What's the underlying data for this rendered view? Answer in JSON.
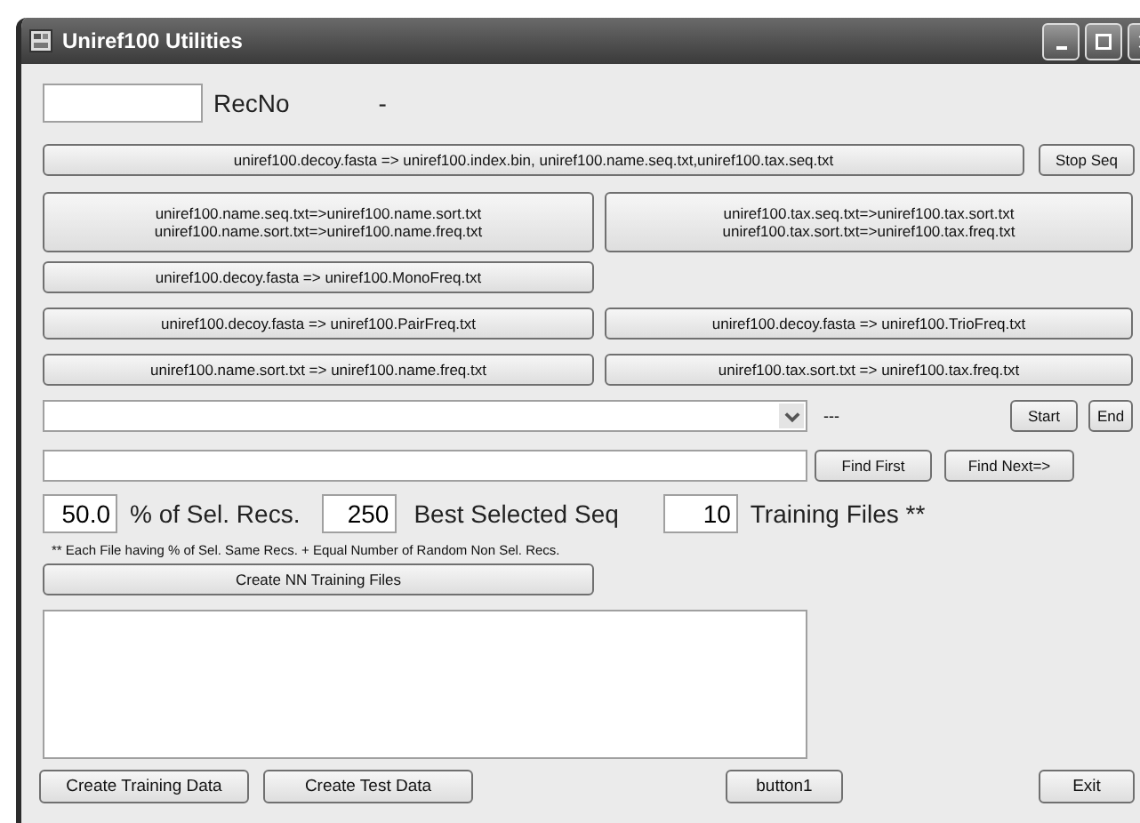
{
  "window": {
    "title": "Uniref100 Utilities"
  },
  "rec_no": {
    "label": "RecNo",
    "status": "-"
  },
  "main_action": {
    "label": "uniref100.decoy.fasta => uniref100.index.bin, uniref100.name.seq.txt,uniref100.tax.seq.txt"
  },
  "stop_button": "Stop Seq",
  "sort_buttons": [
    {
      "lines": [
        "uniref100.name.seq.txt=>uniref100.name.sort.txt",
        "uniref100.name.sort.txt=>uniref100.name.freq.txt"
      ]
    },
    {
      "lines": [
        "uniref100.tax.seq.txt=>uniref100.tax.sort.txt",
        "uniref100.tax.sort.txt=>uniref100.tax.freq.txt"
      ]
    }
  ],
  "mono_button": "uniref100.decoy.fasta => uniref100.MonoFreq.txt",
  "freq_buttons": [
    [
      "uniref100.decoy.fasta => uniref100.PairFreq.txt",
      "uniref100.decoy.fasta => uniref100.TrioFreq.txt"
    ],
    [
      "uniref100.name.sort.txt => uniref100.name.freq.txt",
      "uniref100.tax.sort.txt => uniref100.tax.freq.txt"
    ]
  ],
  "combo": {
    "status": "---"
  },
  "start_button": "Start",
  "end_button": "End",
  "find": {
    "first": "Find First",
    "next": "Find Next=>"
  },
  "params": [
    {
      "value": "50.0",
      "label": "% of Sel. Recs."
    },
    {
      "value": "250",
      "label": "Best Selected Seq"
    },
    {
      "value": "10",
      "label": "Training Files **"
    }
  ],
  "note": "** Each File having  % of Sel. Same Recs. + Equal Number of Random Non Sel. Recs.",
  "create_nn_button": "Create NN Training Files",
  "bottom_buttons": [
    "Create Training Data",
    "Create Test Data",
    "button1",
    "Exit"
  ]
}
